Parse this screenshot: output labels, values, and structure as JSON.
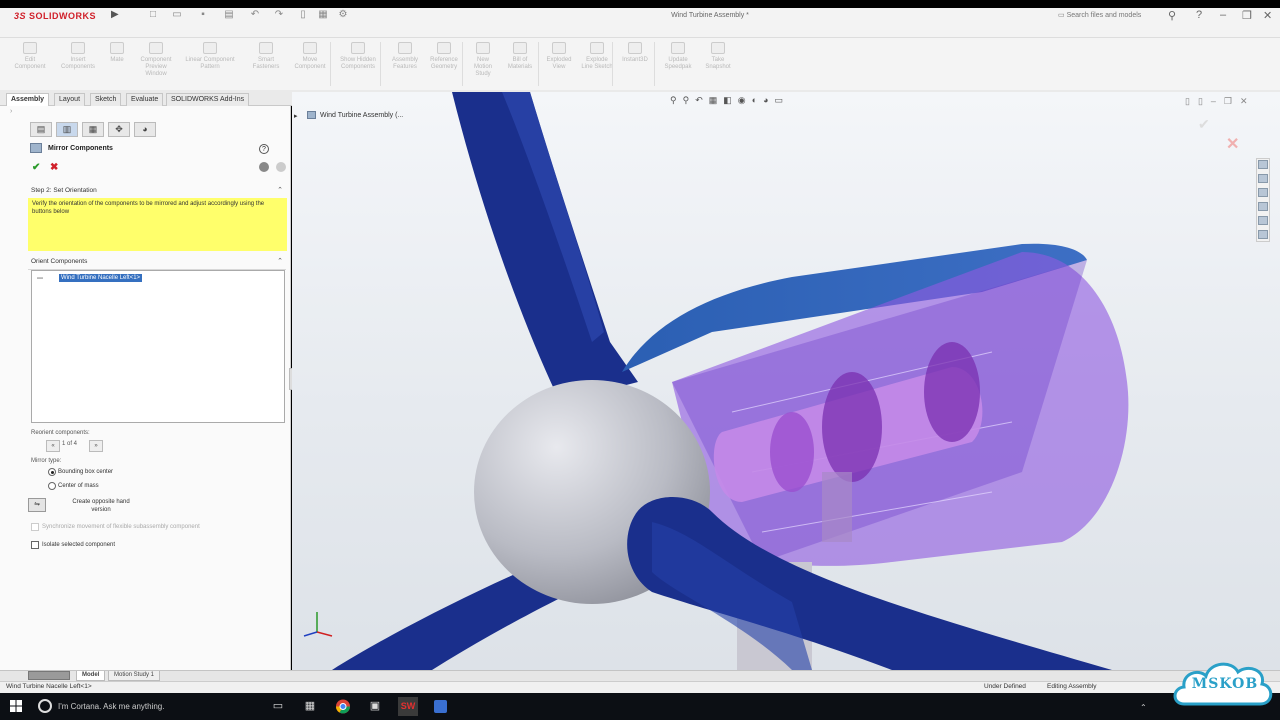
{
  "app": {
    "logo_text": "SOLIDWORKS",
    "logo_ds": "3S",
    "doc_title": "Wind Turbine Assembly *",
    "search_placeholder": "Search files and models"
  },
  "ribbon": {
    "buttons": [
      {
        "label": "Edit Component"
      },
      {
        "label": "Insert Components"
      },
      {
        "label": "Mate"
      },
      {
        "label": "Component Preview Window"
      },
      {
        "label": "Linear Component Pattern"
      },
      {
        "label": "Smart Fasteners"
      },
      {
        "label": "Move Component"
      },
      {
        "label": "Show Hidden Components"
      },
      {
        "label": "Assembly Features"
      },
      {
        "label": "Reference Geometry"
      },
      {
        "label": "New Motion Study"
      },
      {
        "label": "Bill of Materials"
      },
      {
        "label": "Exploded View"
      },
      {
        "label": "Explode Line Sketch"
      },
      {
        "label": "Instant3D"
      },
      {
        "label": "Update Speedpak"
      },
      {
        "label": "Take Snapshot"
      }
    ]
  },
  "tabs": [
    "Assembly",
    "Layout",
    "Sketch",
    "Evaluate",
    "SOLIDWORKS Add-Ins"
  ],
  "panel": {
    "title": "Mirror Components",
    "step_header": "Step 2: Set Orientation",
    "message": "Verify the orientation of the components to be mirrored and adjust accordingly using the buttons below",
    "orient_header": "Orient Components",
    "selected_item": "Wind Turbine Nacelle Left<1>",
    "reorient_label": "Reorient components:",
    "reorient_count": "1 of 4",
    "mirror_type_label": "Mirror type:",
    "radio_bbox": "Bounding box center",
    "radio_mass": "Center of mass",
    "opposite_hand": "Create opposite hand version",
    "sync_label": "Synchronize movement of flexible subassembly component",
    "isolate_label": "Isolate selected component"
  },
  "viewport": {
    "tree_label": "Wind Turbine Assembly (..."
  },
  "bottom_tabs": [
    "Model",
    "Motion Study 1"
  ],
  "status": {
    "left": "Wind Turbine Nacelle Left<1>",
    "under_defined": "Under Defined",
    "editing": "Editing Assembly"
  },
  "taskbar": {
    "cortana": "I'm Cortana. Ask me anything."
  },
  "watermark": "MSKOB",
  "colors": {
    "blade_blue": "#1a2f8c",
    "nacelle_purple": "#8f5be0",
    "hub_gray": "#b5b7bf",
    "accent_red": "#d0202a",
    "message_yellow": "#ffff6b"
  }
}
